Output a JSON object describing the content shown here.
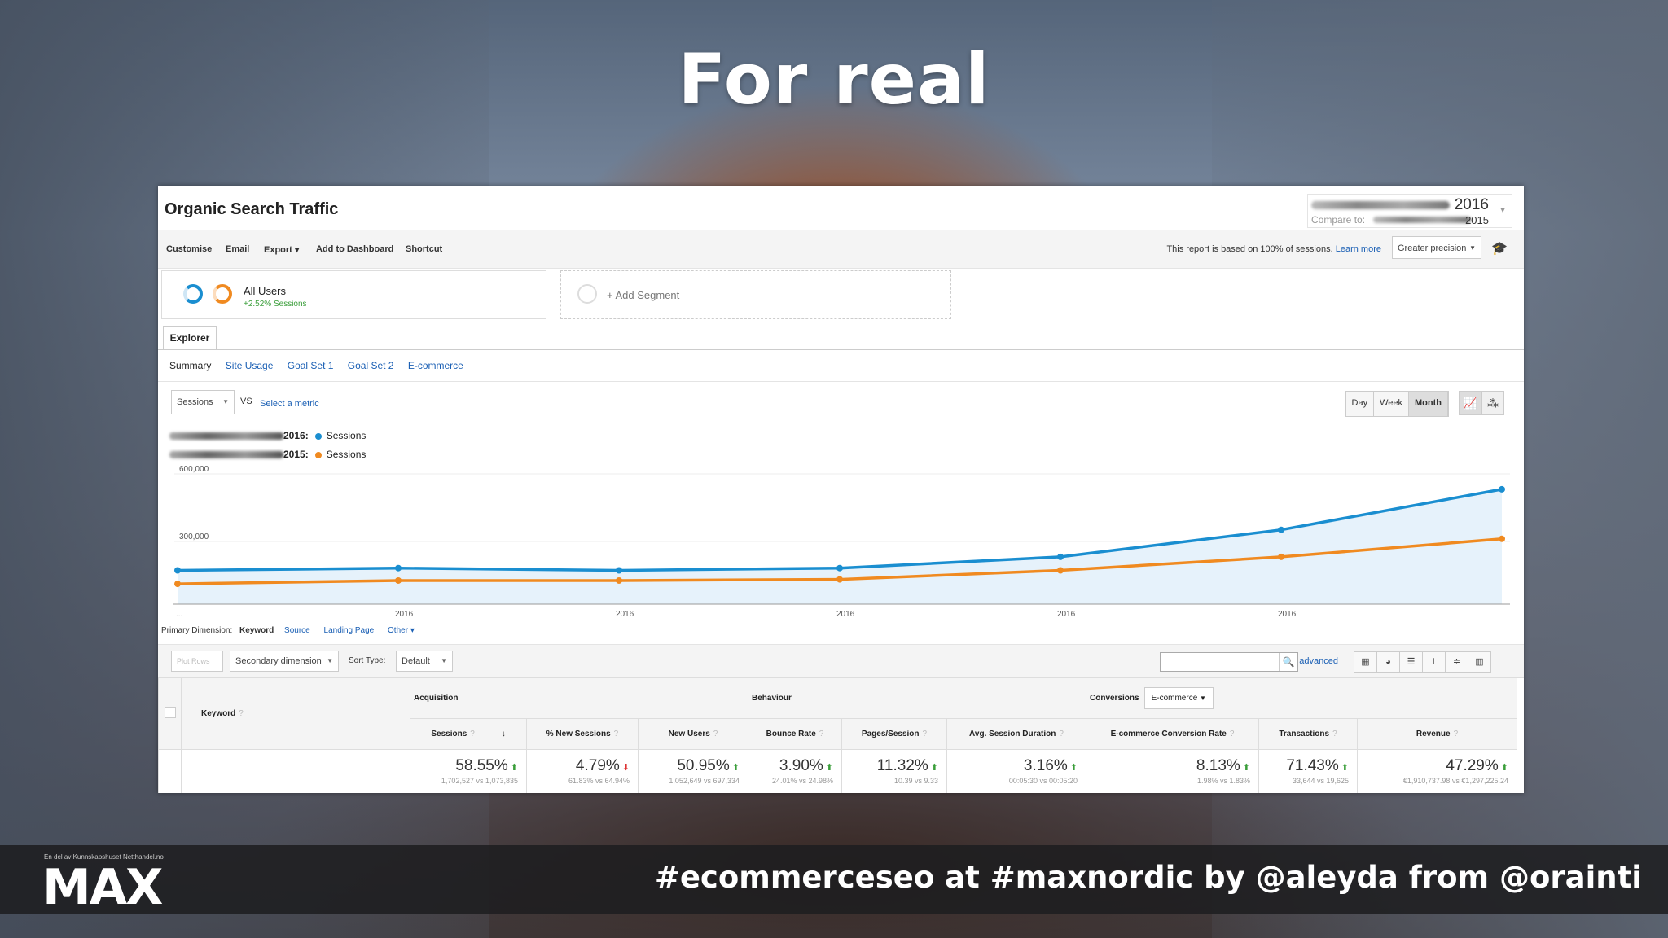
{
  "slide": {
    "title": "For real",
    "footer_small": "En del av Kunnskapshuset Netthandel.no",
    "logo": "MAX",
    "tagline": "#ecommerceseo at #maxnordic by @aleyda from @orainti"
  },
  "report": {
    "title": "Organic Search Traffic",
    "date_current_year": "2016",
    "compare_label": "Compare to:",
    "date_compare_year": "2015",
    "toolbar": [
      "Customise",
      "Email",
      "Export ▾",
      "Add to Dashboard",
      "Shortcut"
    ],
    "sampling_note": "This report is based on 100% of sessions.",
    "learn_more": "Learn more",
    "precision": "Greater precision"
  },
  "segments": {
    "all_users": "All Users",
    "all_users_sub": "+2.52% Sessions",
    "add_segment": "+ Add Segment"
  },
  "explorer": {
    "tab": "Explorer",
    "subtabs": [
      "Summary",
      "Site Usage",
      "Goal Set 1",
      "Goal Set 2",
      "E-commerce"
    ]
  },
  "metric": {
    "selected": "Sessions",
    "vs": "VS",
    "select_metric": "Select a metric",
    "granularity": [
      "Day",
      "Week",
      "Month"
    ],
    "active_granularity": "Month"
  },
  "legend": [
    {
      "year": "2016:",
      "series": "Sessions",
      "color": "#1a8ed0"
    },
    {
      "year": "2015:",
      "series": "Sessions",
      "color": "#f08a20"
    }
  ],
  "chart_data": {
    "type": "line",
    "y_ticks": [
      "600,000",
      "300,000"
    ],
    "ylim": [
      0,
      600000
    ],
    "x_labels": [
      "...",
      "2016",
      "2016",
      "2016",
      "2016",
      "2016"
    ],
    "series": [
      {
        "name": "Sessions",
        "color": "#1a8ed0",
        "values": [
          150000,
          160000,
          150000,
          160000,
          210000,
          330000,
          510000
        ]
      },
      {
        "name": "Sessions",
        "color": "#f08a20",
        "values": [
          90000,
          105000,
          105000,
          110000,
          150000,
          210000,
          290000
        ]
      }
    ]
  },
  "primary_dimension": {
    "label": "Primary Dimension:",
    "active": "Keyword",
    "others": [
      "Source",
      "Landing Page",
      "Other ▾"
    ]
  },
  "controls": {
    "plot_rows": "Plot Rows",
    "secondary_dimension": "Secondary dimension",
    "sort_type_label": "Sort Type:",
    "sort_type": "Default",
    "advanced": "advanced"
  },
  "table": {
    "keyword_header": "Keyword",
    "groups": {
      "acquisition": "Acquisition",
      "behaviour": "Behaviour",
      "conversions": "Conversions",
      "conversions_select": "E-commerce"
    },
    "columns": [
      {
        "label": "Sessions",
        "value": "58.55%",
        "trend": "up",
        "detail": "1,702,527 vs 1,073,835"
      },
      {
        "label": "% New Sessions",
        "value": "4.79%",
        "trend": "down",
        "detail": "61.83% vs 64.94%"
      },
      {
        "label": "New Users",
        "value": "50.95%",
        "trend": "up",
        "detail": "1,052,649 vs 697,334"
      },
      {
        "label": "Bounce Rate",
        "value": "3.90%",
        "trend": "up",
        "detail": "24.01% vs 24.98%"
      },
      {
        "label": "Pages/Session",
        "value": "11.32%",
        "trend": "up",
        "detail": "10.39 vs 9.33"
      },
      {
        "label": "Avg. Session Duration",
        "value": "3.16%",
        "trend": "up",
        "detail": "00:05:30 vs 00:05:20"
      },
      {
        "label": "E-commerce Conversion Rate",
        "value": "8.13%",
        "trend": "up",
        "detail": "1.98% vs 1.83%"
      },
      {
        "label": "Transactions",
        "value": "71.43%",
        "trend": "up",
        "detail": "33,644 vs 19,625"
      },
      {
        "label": "Revenue",
        "value": "47.29%",
        "trend": "up",
        "detail": "€1,910,737.98 vs €1,297,225.24"
      }
    ]
  }
}
